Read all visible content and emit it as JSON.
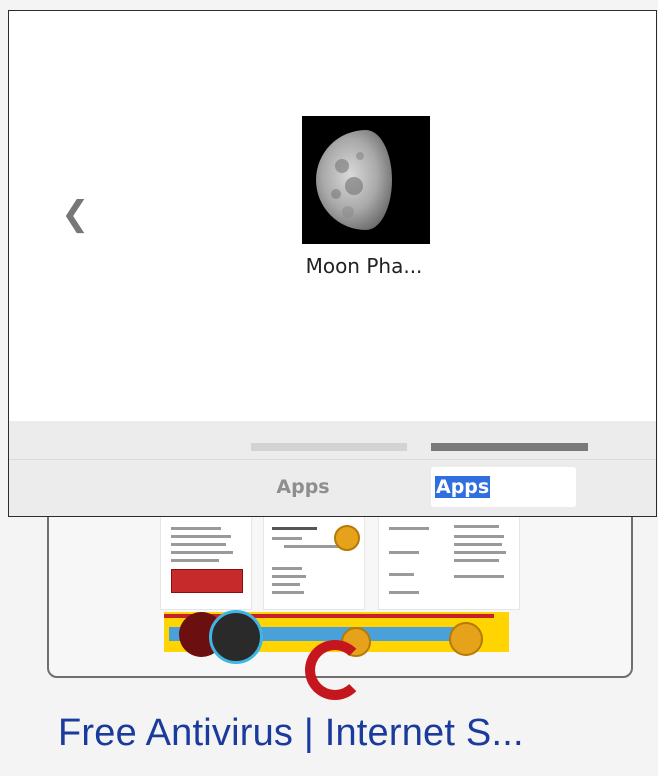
{
  "popup": {
    "app_tile": {
      "label": "Moon Pha...",
      "icon": "moon-phase-icon"
    },
    "nav": {
      "prev_glyph": "❮",
      "prev_icon": "chevron-left-icon"
    },
    "tabs": [
      {
        "label": "Apps",
        "selected": false
      },
      {
        "label": "Apps",
        "selected": true
      }
    ]
  },
  "background": {
    "search_result_title": "Free Antivirus | Internet S...",
    "logo_icon": "c-logo-icon"
  },
  "colors": {
    "link_blue": "#1a3b9c",
    "selection_blue": "#2f6fe0",
    "tab_active": "#7a7a7a",
    "tab_inactive": "#d3d3d3",
    "logo_red": "#c4161c"
  }
}
